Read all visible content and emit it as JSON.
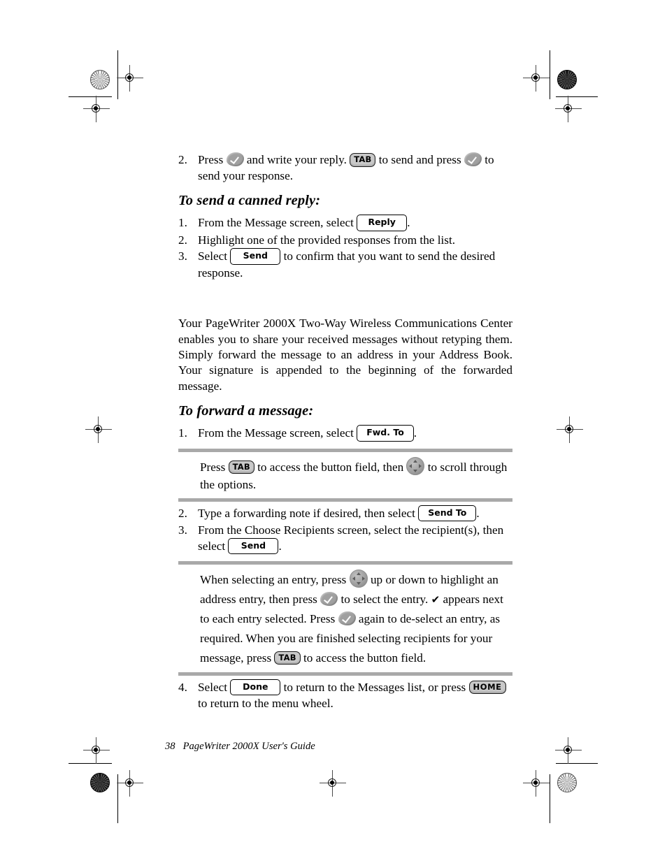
{
  "page": {
    "number": "38",
    "footer_title": "PageWriter 2000X User's Guide"
  },
  "sections": [
    {
      "id": "canned-reply-lead-step",
      "steps": [
        {
          "num": "2.",
          "parts": [
            {
              "t": "text",
              "v": "Press "
            },
            {
              "t": "blob",
              "v": "check-button"
            },
            {
              "t": "text",
              "v": " and write your reply. "
            },
            {
              "t": "key",
              "v": "TAB"
            },
            {
              "t": "text",
              "v": " to send and press "
            },
            {
              "t": "blob",
              "v": "check-button"
            },
            {
              "t": "text",
              "v": " to send your response."
            }
          ]
        }
      ]
    },
    {
      "id": "canned-reply",
      "heading": "To send a canned reply:",
      "steps": [
        {
          "num": "1.",
          "parts": [
            {
              "t": "text",
              "v": "From the Message screen, select "
            },
            {
              "t": "btn",
              "v": "Reply"
            },
            {
              "t": "text",
              "v": "."
            }
          ]
        },
        {
          "num": "2.",
          "parts": [
            {
              "t": "text",
              "v": "Highlight one of the provided responses from the list."
            }
          ]
        },
        {
          "num": "3.",
          "parts": [
            {
              "t": "text",
              "v": "Select "
            },
            {
              "t": "btn",
              "v": "Send"
            },
            {
              "t": "text",
              "v": " to confirm that you want to send the desired response."
            }
          ]
        }
      ]
    }
  ],
  "intro_paragraph": "Your PageWriter 2000X Two-Way Wireless Communications Center enables you to share your received messages without retyping them. Simply forward the message to an address in your Address Book. Your signature is appended to the beginning of the forwarded message.",
  "forward_section": {
    "heading": "To forward a message:",
    "step1": {
      "num": "1.",
      "pre": "From the Message screen, select ",
      "button": "Fwd. To",
      "post": "."
    },
    "note1": {
      "pre": "Press ",
      "key": "TAB",
      "mid": " to access the button field, then ",
      "wheel": "scroll-wheel",
      "post": " to scroll through the options."
    },
    "step2": {
      "num": "2.",
      "pre": "Type a forwarding note if desired, then select ",
      "button": "Send To",
      "post": "."
    },
    "step3": {
      "num": "3.",
      "pre": "From the Choose Recipients screen, select the recipient(s), then select ",
      "button": "Send",
      "post": "."
    },
    "note2": {
      "p1_pre": "When selecting an entry, press ",
      "p1_wheel": "scroll-wheel",
      "p1_mid": " up or down to highlight an address entry, then press ",
      "p1_blob": "check-button",
      "p1_post": " to select the entry. ",
      "p1_tick": "✔",
      "p2_pre": "appears next to each entry selected. Press ",
      "p2_blob": "check-button",
      "p2_mid": " again to de-select an entry, as required. When you are finished selecting recipients for your message, press ",
      "p2_key": "TAB",
      "p2_post": " to access the button field."
    },
    "step4": {
      "num": "4.",
      "pre": "Select ",
      "button": "Done",
      "mid": " to return to the Messages list, or press ",
      "key": "HOME",
      "post": " to return to the menu wheel."
    }
  },
  "colors": {
    "note_bar": "#a9a9a9",
    "key_fill": "#c9c9c9",
    "blob_fill": "#a0a0a0"
  }
}
